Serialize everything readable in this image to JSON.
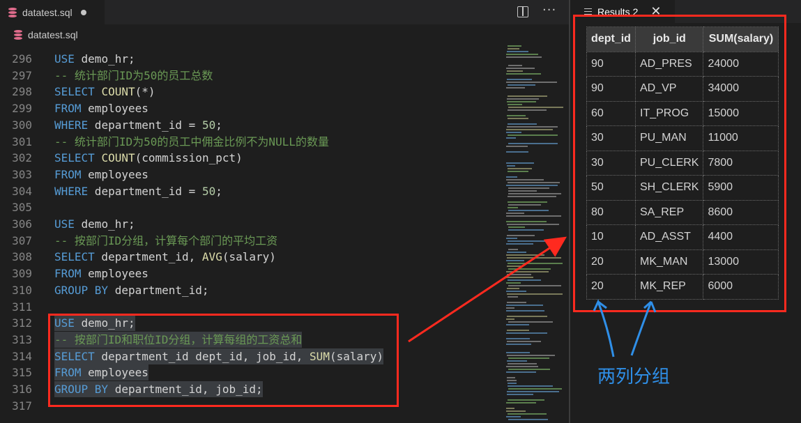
{
  "editor": {
    "tab_title": "datatest.sql",
    "breadcrumb_file": "datatest.sql",
    "more_label": "···"
  },
  "code_lines": [
    {
      "n": "296",
      "tokens": [
        [
          "kw",
          "USE"
        ],
        [
          "id",
          " demo_hr;"
        ]
      ]
    },
    {
      "n": "297",
      "tokens": [
        [
          "cm",
          "-- 统计部门ID为50的员工总数"
        ]
      ]
    },
    {
      "n": "298",
      "tokens": [
        [
          "kw",
          "SELECT"
        ],
        [
          "id",
          " "
        ],
        [
          "fn",
          "COUNT"
        ],
        [
          "id",
          "(*)"
        ]
      ]
    },
    {
      "n": "299",
      "tokens": [
        [
          "kw",
          "FROM"
        ],
        [
          "id",
          " employees"
        ]
      ]
    },
    {
      "n": "300",
      "tokens": [
        [
          "kw",
          "WHERE"
        ],
        [
          "id",
          " department_id = "
        ],
        [
          "num",
          "50"
        ],
        [
          "id",
          ";"
        ]
      ]
    },
    {
      "n": "301",
      "tokens": [
        [
          "cm",
          "-- 统计部门ID为50的员工中佣金比例不为NULL的数量"
        ]
      ]
    },
    {
      "n": "302",
      "tokens": [
        [
          "kw",
          "SELECT"
        ],
        [
          "id",
          " "
        ],
        [
          "fn",
          "COUNT"
        ],
        [
          "id",
          "(commission_pct)"
        ]
      ]
    },
    {
      "n": "303",
      "tokens": [
        [
          "kw",
          "FROM"
        ],
        [
          "id",
          " employees"
        ]
      ]
    },
    {
      "n": "304",
      "tokens": [
        [
          "kw",
          "WHERE"
        ],
        [
          "id",
          " department_id = "
        ],
        [
          "num",
          "50"
        ],
        [
          "id",
          ";"
        ]
      ]
    },
    {
      "n": "305",
      "tokens": []
    },
    {
      "n": "306",
      "tokens": [
        [
          "kw",
          "USE"
        ],
        [
          "id",
          " demo_hr;"
        ]
      ]
    },
    {
      "n": "307",
      "tokens": [
        [
          "cm",
          "-- 按部门ID分组，计算每个部门的平均工资"
        ]
      ]
    },
    {
      "n": "308",
      "tokens": [
        [
          "kw",
          "SELECT"
        ],
        [
          "id",
          " department_id, "
        ],
        [
          "fn",
          "AVG"
        ],
        [
          "id",
          "(salary)"
        ]
      ]
    },
    {
      "n": "309",
      "tokens": [
        [
          "kw",
          "FROM"
        ],
        [
          "id",
          " employees"
        ]
      ]
    },
    {
      "n": "310",
      "tokens": [
        [
          "kw",
          "GROUP BY"
        ],
        [
          "id",
          " department_id;"
        ]
      ]
    },
    {
      "n": "311",
      "tokens": []
    },
    {
      "n": "312",
      "tokens": [
        [
          "kw",
          "USE"
        ],
        [
          "id",
          " demo_hr;"
        ]
      ],
      "hl": true
    },
    {
      "n": "313",
      "tokens": [
        [
          "cm",
          "-- 按部门ID和职位ID分组，计算每组的工资总和"
        ]
      ],
      "hl": true
    },
    {
      "n": "314",
      "tokens": [
        [
          "kw",
          "SELECT"
        ],
        [
          "id",
          " department_id dept_id, job_id, "
        ],
        [
          "fn",
          "SUM"
        ],
        [
          "id",
          "(salary)"
        ]
      ],
      "hl": true
    },
    {
      "n": "315",
      "tokens": [
        [
          "kw",
          "FROM"
        ],
        [
          "id",
          " employees"
        ]
      ],
      "hl": true
    },
    {
      "n": "316",
      "tokens": [
        [
          "kw",
          "GROUP BY"
        ],
        [
          "id",
          " department_id, job_id;"
        ]
      ],
      "hl": true
    },
    {
      "n": "317",
      "tokens": []
    }
  ],
  "results": {
    "tab_title": "Results 2",
    "close_label": "✕",
    "columns": [
      "dept_id",
      "job_id",
      "SUM(salary)"
    ],
    "rows": [
      [
        "90",
        "AD_PRES",
        "24000"
      ],
      [
        "90",
        "AD_VP",
        "34000"
      ],
      [
        "60",
        "IT_PROG",
        "15000"
      ],
      [
        "30",
        "PU_MAN",
        "11000"
      ],
      [
        "30",
        "PU_CLERK",
        "7800"
      ],
      [
        "50",
        "SH_CLERK",
        "5900"
      ],
      [
        "80",
        "SA_REP",
        "8600"
      ],
      [
        "10",
        "AD_ASST",
        "4400"
      ],
      [
        "20",
        "MK_MAN",
        "13000"
      ],
      [
        "20",
        "MK_REP",
        "6000"
      ]
    ]
  },
  "annotation": {
    "label": "两列分组",
    "box_color": "#ff2a1f",
    "arrow_color": "#2f8fe8"
  },
  "colors": {
    "keyword": "#569cd6",
    "comment": "#6a9955",
    "number": "#b5cea8",
    "function": "#dcdcaa"
  }
}
